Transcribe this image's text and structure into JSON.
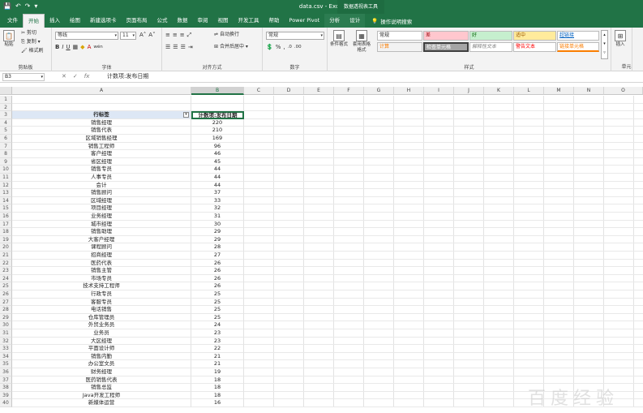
{
  "window": {
    "title": "data.csv  -  Excel",
    "context_title": "数据透视表工具"
  },
  "qat": {
    "save": "💾",
    "undo": "↶",
    "redo": "↷",
    "more": "▾"
  },
  "tabs": [
    {
      "label": "文件"
    },
    {
      "label": "开始"
    },
    {
      "label": "插入"
    },
    {
      "label": "绘图"
    },
    {
      "label": "新建选项卡"
    },
    {
      "label": "页面布局"
    },
    {
      "label": "公式"
    },
    {
      "label": "数据"
    },
    {
      "label": "审阅"
    },
    {
      "label": "视图"
    },
    {
      "label": "开发工具"
    },
    {
      "label": "帮助"
    },
    {
      "label": "Power Pivot"
    },
    {
      "label": "分析"
    },
    {
      "label": "设计"
    }
  ],
  "tell_me": "操作说明搜索",
  "ribbon": {
    "clipboard": {
      "label": "剪贴板",
      "paste": "粘贴",
      "cut": "剪切",
      "copy": "复制 ▾",
      "format_painter": "格式刷"
    },
    "font": {
      "label": "字体",
      "name": "等线",
      "size": "11",
      "grow": "A˄",
      "shrink": "A˅",
      "bold": "B",
      "italic": "I",
      "underline": "U",
      "wen": "wén"
    },
    "alignment": {
      "label": "对齐方式",
      "wrap": "自动换行",
      "merge": "合并后居中 ▾"
    },
    "number": {
      "label": "数字",
      "format": "常规",
      "percent": "%",
      "comma": ",",
      "inc": ".0",
      "dec": ".00"
    },
    "styles": {
      "label": "样式",
      "conditional": "条件格式",
      "table_format": "套用表格格式",
      "cells": [
        {
          "text": "常规"
        },
        {
          "text": "差"
        },
        {
          "text": "好"
        },
        {
          "text": "适中"
        },
        {
          "text": "超链接"
        },
        {
          "text": "计算"
        },
        {
          "text": "检查单元格"
        },
        {
          "text": "解释性文本"
        },
        {
          "text": "警告文本"
        },
        {
          "text": "链接单元格"
        }
      ]
    },
    "insert": {
      "label": "插入"
    },
    "cells_group": {
      "label": "单元"
    }
  },
  "formula_bar": {
    "name_box": "B3",
    "cancel": "✕",
    "enter": "✓",
    "fx": "fx",
    "content": "计数项:发布日期"
  },
  "columns": [
    "A",
    "B",
    "C",
    "D",
    "E",
    "F",
    "G",
    "H",
    "I",
    "J",
    "K",
    "L",
    "M",
    "N",
    "O"
  ],
  "header_row": {
    "a": "行标签",
    "b": "计数项:发布日期",
    "filter": "▾"
  },
  "rows": [
    {
      "n": "1",
      "a": "",
      "b": ""
    },
    {
      "n": "2",
      "a": "",
      "b": ""
    },
    {
      "n": "3",
      "a": "行标签",
      "b": "计数项:发布日期",
      "header": true
    },
    {
      "n": "4",
      "a": "销售经理",
      "b": "220"
    },
    {
      "n": "5",
      "a": "销售代表",
      "b": "210"
    },
    {
      "n": "6",
      "a": "区域销售经理",
      "b": "169"
    },
    {
      "n": "7",
      "a": "销售工程师",
      "b": "96"
    },
    {
      "n": "8",
      "a": "客户经理",
      "b": "46"
    },
    {
      "n": "9",
      "a": "省区经理",
      "b": "45"
    },
    {
      "n": "10",
      "a": "销售专员",
      "b": "44"
    },
    {
      "n": "11",
      "a": "人事专员",
      "b": "44"
    },
    {
      "n": "12",
      "a": "会计",
      "b": "44"
    },
    {
      "n": "13",
      "a": "销售顾问",
      "b": "37"
    },
    {
      "n": "14",
      "a": "区域经理",
      "b": "33"
    },
    {
      "n": "15",
      "a": "项目经理",
      "b": "32"
    },
    {
      "n": "16",
      "a": "业务经理",
      "b": "31"
    },
    {
      "n": "17",
      "a": "城市经理",
      "b": "30"
    },
    {
      "n": "18",
      "a": "销售助理",
      "b": "29"
    },
    {
      "n": "19",
      "a": "大客户经理",
      "b": "29"
    },
    {
      "n": "20",
      "a": "课程顾问",
      "b": "28"
    },
    {
      "n": "21",
      "a": "招商经理",
      "b": "27"
    },
    {
      "n": "22",
      "a": "医药代表",
      "b": "26"
    },
    {
      "n": "23",
      "a": "销售主管",
      "b": "26"
    },
    {
      "n": "24",
      "a": "市场专员",
      "b": "26"
    },
    {
      "n": "25",
      "a": "技术支持工程师",
      "b": "26"
    },
    {
      "n": "26",
      "a": "行政专员",
      "b": "25"
    },
    {
      "n": "27",
      "a": "客服专员",
      "b": "25"
    },
    {
      "n": "28",
      "a": "电话销售",
      "b": "25"
    },
    {
      "n": "29",
      "a": "仓库管理员",
      "b": "25"
    },
    {
      "n": "30",
      "a": "外贸业务员",
      "b": "24"
    },
    {
      "n": "31",
      "a": "业务员",
      "b": "23"
    },
    {
      "n": "32",
      "a": "大区经理",
      "b": "23"
    },
    {
      "n": "33",
      "a": "平面设计师",
      "b": "22"
    },
    {
      "n": "34",
      "a": "销售内勤",
      "b": "21"
    },
    {
      "n": "35",
      "a": "办公室文员",
      "b": "21"
    },
    {
      "n": "36",
      "a": "财务经理",
      "b": "19"
    },
    {
      "n": "37",
      "a": "医药销售代表",
      "b": "18"
    },
    {
      "n": "38",
      "a": "销售总监",
      "b": "18"
    },
    {
      "n": "39",
      "a": "Java开发工程师",
      "b": "18"
    },
    {
      "n": "40",
      "a": "新媒体运营",
      "b": "16"
    }
  ],
  "watermark": "百度经验"
}
